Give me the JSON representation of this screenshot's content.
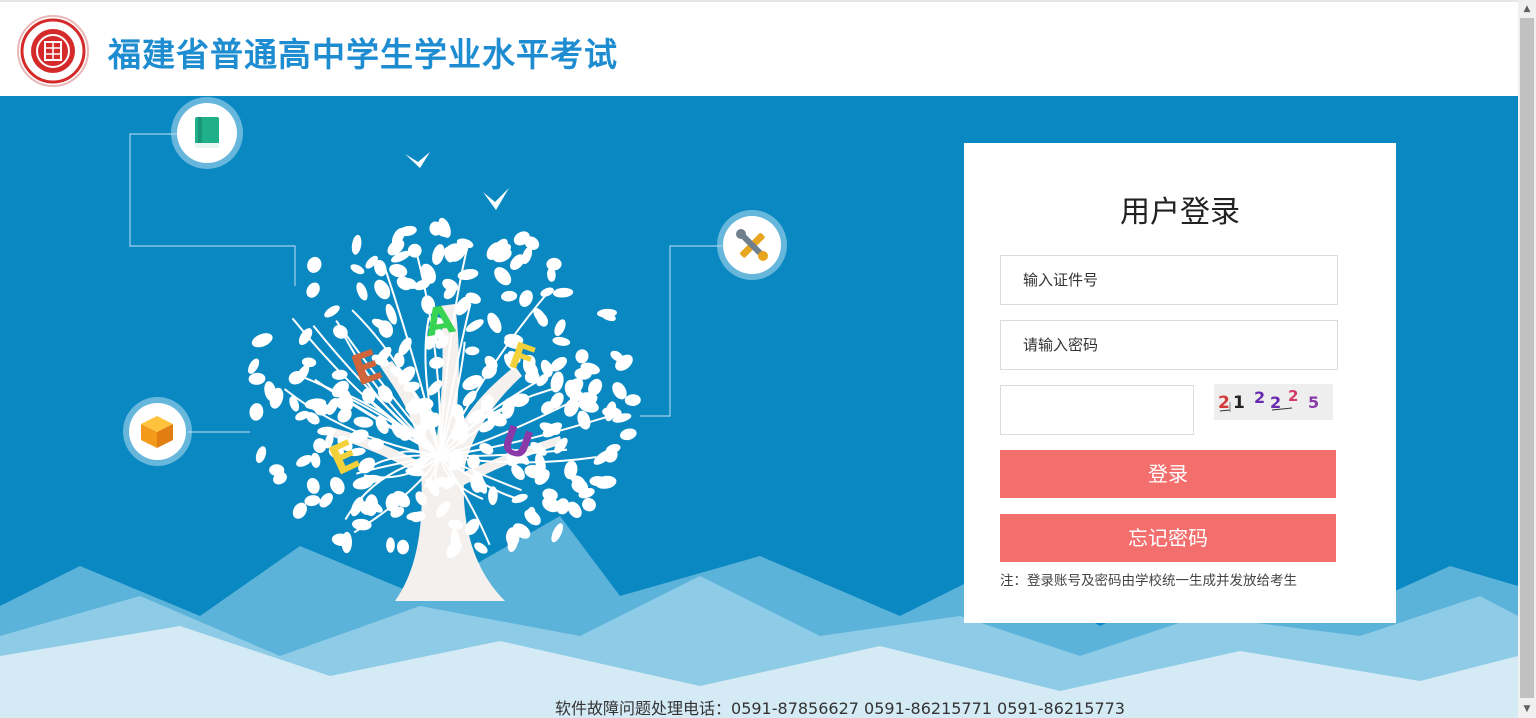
{
  "header": {
    "title": "福建省普通高中学生学业水平考试",
    "logo_icon": "school-seal-icon",
    "logo_color": "#d42a2a",
    "title_color": "#1e8cd0"
  },
  "hero": {
    "background_color": "#0a88c2",
    "letters": [
      "A",
      "E",
      "F",
      "E",
      "U"
    ],
    "icons": [
      "book-icon",
      "tools-icon",
      "cube-icon"
    ]
  },
  "login": {
    "title": "用户登录",
    "id_placeholder": "输入证件号",
    "password_placeholder": "请输入密码",
    "captcha_value": "",
    "captcha_text": "2122 25",
    "login_button": "登录",
    "forgot_button": "忘记密码",
    "note": "注：登录账号及密码由学校统一生成并发放给考生",
    "button_color": "#f36f6e"
  },
  "footer": {
    "support_text": "软件故障问题处理电话：0591-87856627 0591-86215771 0591-86215773"
  }
}
